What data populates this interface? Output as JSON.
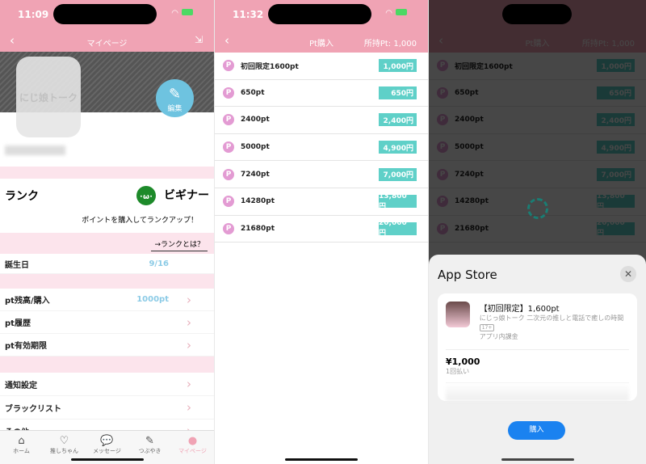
{
  "mypage": {
    "time": "11:09",
    "title": "マイページ",
    "edit_label": "編集",
    "avatar_text": "にじ娘トーク",
    "rank_label": "ランク",
    "rank_value": "ビギナー",
    "rank_hint": "ポイントを購入してランクアップ！",
    "rank_link": "→ランクとは？",
    "birthday_label": "誕生日",
    "birthday_value": "9/16",
    "items": [
      {
        "label": "pt残高/購入",
        "value": "1000pt"
      },
      {
        "label": "pt履歴"
      },
      {
        "label": "pt有効期限"
      }
    ],
    "settings": [
      {
        "label": "通知設定"
      },
      {
        "label": "ブラックリスト"
      },
      {
        "label": "その他"
      }
    ],
    "tabs": [
      {
        "label": "ホーム",
        "icon": "home-icon"
      },
      {
        "label": "推しちゃん",
        "icon": "heart-icon"
      },
      {
        "label": "メッセージ",
        "icon": "chat-icon"
      },
      {
        "label": "つぶやき",
        "icon": "compose-icon"
      },
      {
        "label": "マイページ",
        "icon": "person-icon",
        "active": true
      }
    ]
  },
  "purchase": {
    "time": "11:32",
    "title": "Pt購入",
    "balance": "所持Pt: 1,000",
    "items": [
      {
        "name": "初回限定1600pt",
        "price": "1,000円"
      },
      {
        "name": "650pt",
        "price": "650円"
      },
      {
        "name": "2400pt",
        "price": "2,400円"
      },
      {
        "name": "5000pt",
        "price": "4,900円"
      },
      {
        "name": "7240pt",
        "price": "7,000円"
      },
      {
        "name": "14280pt",
        "price": "13,800円"
      },
      {
        "name": "21680pt",
        "price": "20,000円"
      }
    ]
  },
  "appstore": {
    "title": "App Store",
    "product": "【初回限定】1,600pt",
    "app": "にじっ娘トーク 二次元の推しと電話で癒しの時間",
    "age": "17+",
    "type": "アプリ内課金",
    "price": "¥1,000",
    "payment": "1回払い",
    "buy": "購入"
  },
  "colors": {
    "header": "#f0a3b4",
    "price": "#5fd0c8",
    "accent": "#1a82f0"
  }
}
